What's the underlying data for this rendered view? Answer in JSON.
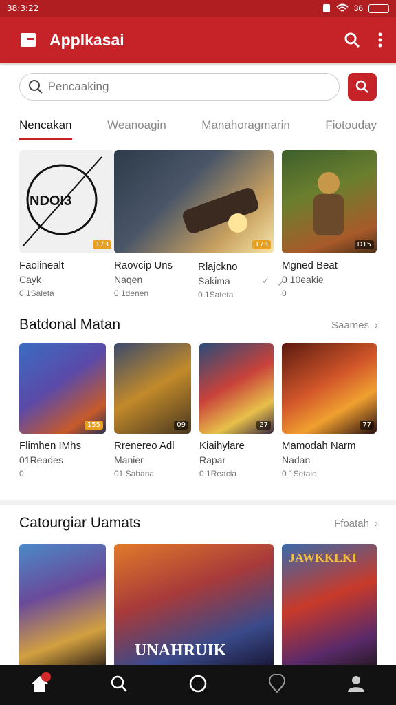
{
  "status": {
    "time": "38:3:22",
    "signal": "36"
  },
  "app": {
    "title": "Applkasai"
  },
  "search": {
    "placeholder": "Pencaaking"
  },
  "tabs": [
    "Nencakan",
    "Weanoagin",
    "Manahoragmarin",
    "Fiotouday"
  ],
  "featured": [
    {
      "title": "Faolinealt",
      "subtitle": "Cayk",
      "meta": "0 1Saleta",
      "badge": "173",
      "logo": "NDOI3"
    },
    {
      "title": "Raovcip Uns",
      "subtitle": "Naqen",
      "meta": "0 1denen",
      "badge": "173"
    },
    {
      "title": "Rlajckno",
      "subtitle": "Sakima",
      "meta": "0 1Sateta",
      "badge": ""
    },
    {
      "title": "Mgned Beat",
      "subtitle": "0 10eakie",
      "meta": "0",
      "badge": "D15"
    }
  ],
  "section1": {
    "title": "Batdonal Matan",
    "more": "Saames"
  },
  "section1_items": [
    {
      "title": "Flimhen IMhs",
      "subtitle": "01Reades",
      "meta": "0",
      "badge": "155"
    },
    {
      "title": "Rrenereo Adl",
      "subtitle": "Manier",
      "meta": "01 Sabana",
      "badge": "09"
    },
    {
      "title": "Kiaihylare",
      "subtitle": "Rapar",
      "meta": "0 1Reacia",
      "badge": "27"
    },
    {
      "title": "Mamodah Narm",
      "subtitle": "Nadan",
      "meta": "0 1Setaio",
      "badge": "77"
    }
  ],
  "section2": {
    "title": "Catourgiar Uamats",
    "more": "Ffoatah"
  },
  "section2_items": [
    {
      "banner": ""
    },
    {
      "banner": "UNAHRUIK"
    },
    {
      "banner": "JAWKKLKI"
    }
  ],
  "nav": [
    "home",
    "search",
    "circle",
    "location",
    "profile"
  ],
  "colors": {
    "brand": "#c62328",
    "nav_bg": "#121212"
  }
}
